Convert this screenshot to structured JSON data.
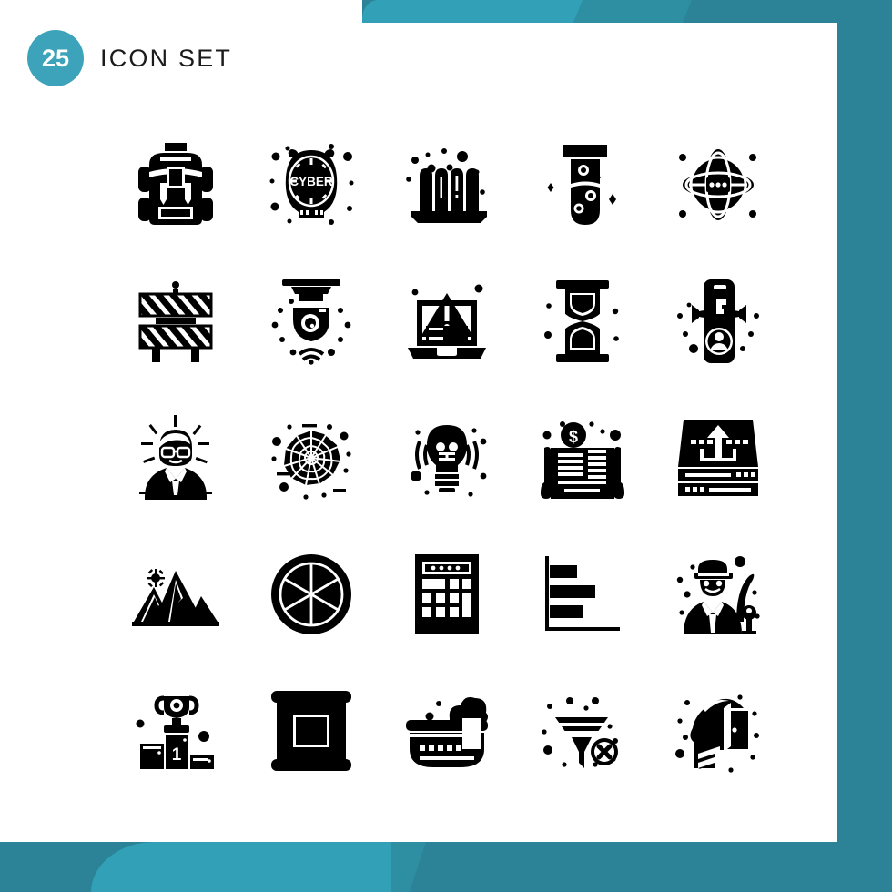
{
  "header": {
    "badge_count": "25",
    "title": "Icon Set",
    "badge_color": "#3DA3BA",
    "title_color": "#1b1b1b"
  },
  "theme": {
    "background": "#ffffff",
    "banner_dark": "#2C8296",
    "banner_mid": "#2E8EA2",
    "banner_light": "#32A0B6",
    "icon_color": "#000000"
  },
  "grid": {
    "columns": 5,
    "rows": 5,
    "total_icons": 25
  },
  "icons": [
    {
      "index": 1,
      "row": 1,
      "col": 1,
      "name": "backpack-icon",
      "label": "Backpack"
    },
    {
      "index": 2,
      "row": 1,
      "col": 2,
      "name": "cyber-alarm-clock-icon",
      "label": "Cyber Alarm Clock",
      "text": "CYBER"
    },
    {
      "index": 3,
      "row": 1,
      "col": 3,
      "name": "test-tube-rack-icon",
      "label": "Test Tube Rack"
    },
    {
      "index": 4,
      "row": 1,
      "col": 4,
      "name": "test-tube-icon",
      "label": "Test Tube"
    },
    {
      "index": 5,
      "row": 1,
      "col": 5,
      "name": "globe-network-icon",
      "label": "Global Network"
    },
    {
      "index": 6,
      "row": 2,
      "col": 1,
      "name": "road-barrier-icon",
      "label": "Road Barrier"
    },
    {
      "index": 7,
      "row": 2,
      "col": 2,
      "name": "cctv-camera-icon",
      "label": "CCTV Camera"
    },
    {
      "index": 8,
      "row": 2,
      "col": 3,
      "name": "laptop-warning-icon",
      "label": "Laptop Warning"
    },
    {
      "index": 9,
      "row": 2,
      "col": 4,
      "name": "hourglass-icon",
      "label": "Hourglass"
    },
    {
      "index": 10,
      "row": 2,
      "col": 5,
      "name": "mobile-marketing-icon",
      "label": "Mobile Marketing"
    },
    {
      "index": 11,
      "row": 3,
      "col": 1,
      "name": "smart-person-icon",
      "label": "Smart Person"
    },
    {
      "index": 12,
      "row": 3,
      "col": 2,
      "name": "spider-web-icon",
      "label": "Spider Web"
    },
    {
      "index": 13,
      "row": 3,
      "col": 3,
      "name": "idea-bulb-icon",
      "label": "Idea Bulb"
    },
    {
      "index": 14,
      "row": 3,
      "col": 4,
      "name": "financial-news-icon",
      "label": "Financial News"
    },
    {
      "index": 15,
      "row": 3,
      "col": 5,
      "name": "server-upload-icon",
      "label": "Server Upload"
    },
    {
      "index": 16,
      "row": 4,
      "col": 1,
      "name": "mountains-icon",
      "label": "Mountains"
    },
    {
      "index": 17,
      "row": 4,
      "col": 2,
      "name": "pie-chart-wheel-icon",
      "label": "Pie Chart Wheel"
    },
    {
      "index": 18,
      "row": 4,
      "col": 3,
      "name": "calculator-icon",
      "label": "Calculator"
    },
    {
      "index": 19,
      "row": 4,
      "col": 4,
      "name": "bar-chart-icon",
      "label": "Bar Chart"
    },
    {
      "index": 20,
      "row": 4,
      "col": 5,
      "name": "golfer-icon",
      "label": "Golfer"
    },
    {
      "index": 21,
      "row": 5,
      "col": 1,
      "name": "winner-podium-icon",
      "label": "Winner Podium",
      "text": "1"
    },
    {
      "index": 22,
      "row": 5,
      "col": 2,
      "name": "scroll-banner-icon",
      "label": "Scroll Banner"
    },
    {
      "index": 23,
      "row": 5,
      "col": 3,
      "name": "bathtub-icon",
      "label": "Bathtub"
    },
    {
      "index": 24,
      "row": 5,
      "col": 4,
      "name": "filter-remove-icon",
      "label": "Filter Remove"
    },
    {
      "index": 25,
      "row": 5,
      "col": 5,
      "name": "open-mind-door-icon",
      "label": "Open Mind Door"
    }
  ]
}
